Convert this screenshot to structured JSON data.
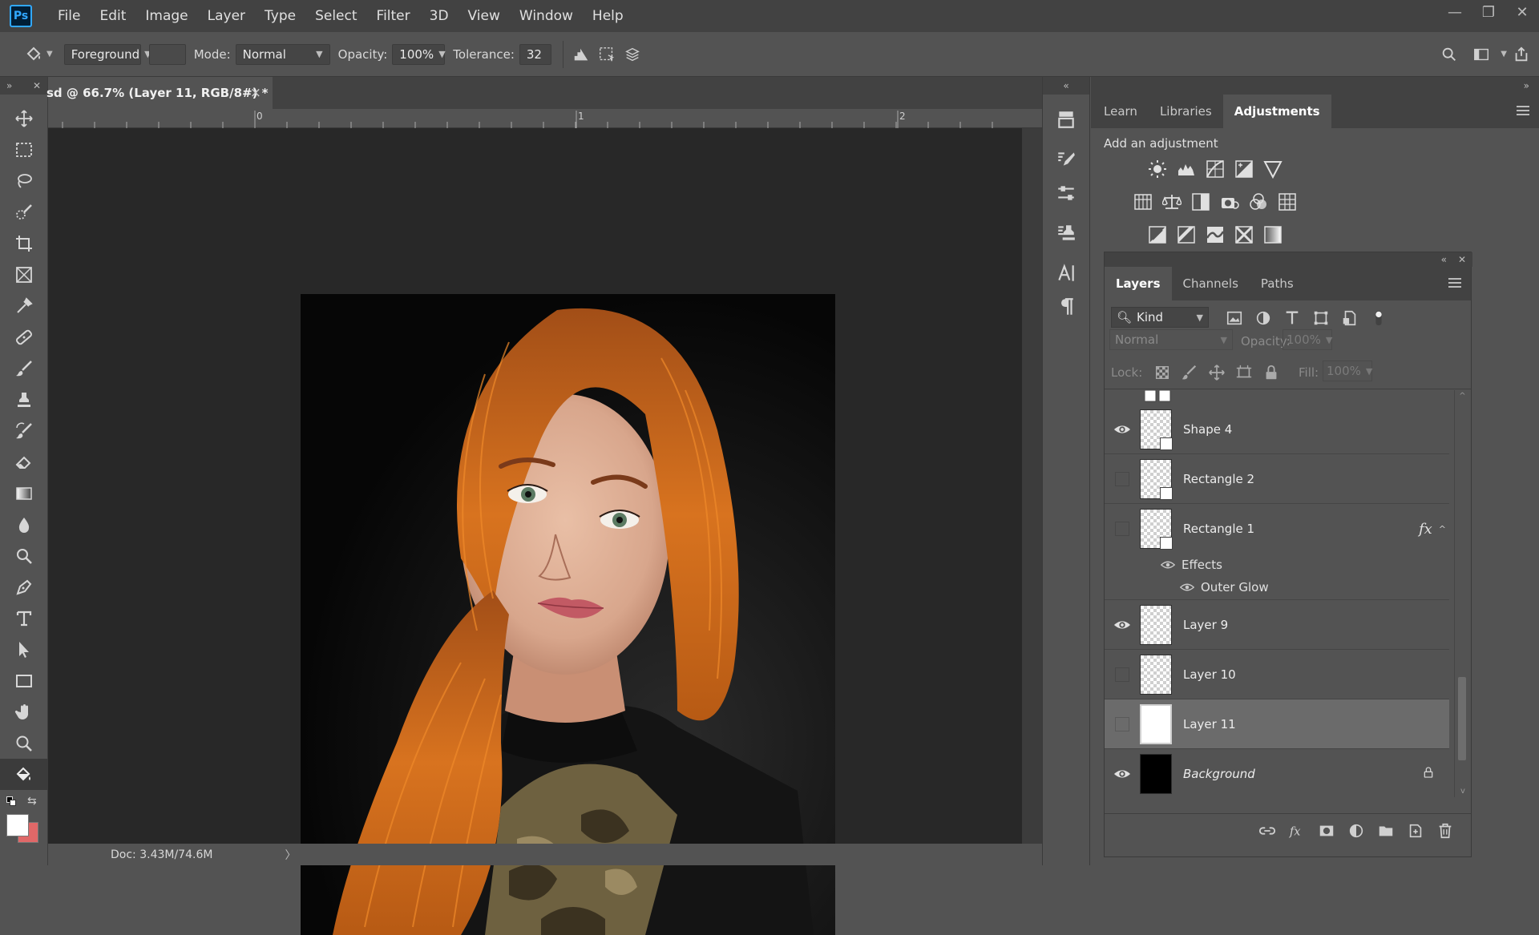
{
  "app": {
    "logo": "Ps"
  },
  "menu": [
    "File",
    "Edit",
    "Image",
    "Layer",
    "Type",
    "Select",
    "Filter",
    "3D",
    "View",
    "Window",
    "Help"
  ],
  "window_controls": {
    "minimize": "—",
    "restore": "❐",
    "close": "✕"
  },
  "options": {
    "fill_source": "Foreground",
    "mode_label": "Mode:",
    "mode_value": "Normal",
    "opacity_label": "Opacity:",
    "opacity_value": "100%",
    "tolerance_label": "Tolerance:",
    "tolerance_value": "32"
  },
  "document": {
    "tab_title": "sd @ 66.7% (Layer 11, RGB/8#) *",
    "tab_close": "×",
    "ruler_labels": [
      "0",
      "1",
      "2"
    ],
    "status": "Doc: 3.43M/74.6M",
    "status_arrow": "〉"
  },
  "top_panel": {
    "tabs": [
      "Learn",
      "Libraries",
      "Adjustments"
    ],
    "active_tab": "Adjustments",
    "heading": "Add an adjustment"
  },
  "layers_panel": {
    "tabs": [
      "Layers",
      "Channels",
      "Paths"
    ],
    "active_tab": "Layers",
    "filter_label": "Kind",
    "blend_mode": "Normal",
    "opacity_label": "Opacity:",
    "opacity_value": "100%",
    "lock_label": "Lock:",
    "fill_label": "Fill:",
    "fill_value": "100%",
    "layers": [
      {
        "name": "Shape 4",
        "visible": true,
        "type": "shape"
      },
      {
        "name": "Rectangle 2",
        "visible": false,
        "type": "shape"
      },
      {
        "name": "Rectangle 1",
        "visible": false,
        "type": "shape",
        "fx": "fx"
      },
      {
        "name": "Layer 9",
        "visible": true,
        "type": "pixel"
      },
      {
        "name": "Layer 10",
        "visible": false,
        "type": "pixel"
      },
      {
        "name": "Layer 11",
        "visible": false,
        "type": "white",
        "selected": true
      },
      {
        "name": "Background",
        "visible": true,
        "type": "black",
        "locked": true
      }
    ],
    "effects_label": "Effects",
    "effect_item": "Outer Glow"
  }
}
